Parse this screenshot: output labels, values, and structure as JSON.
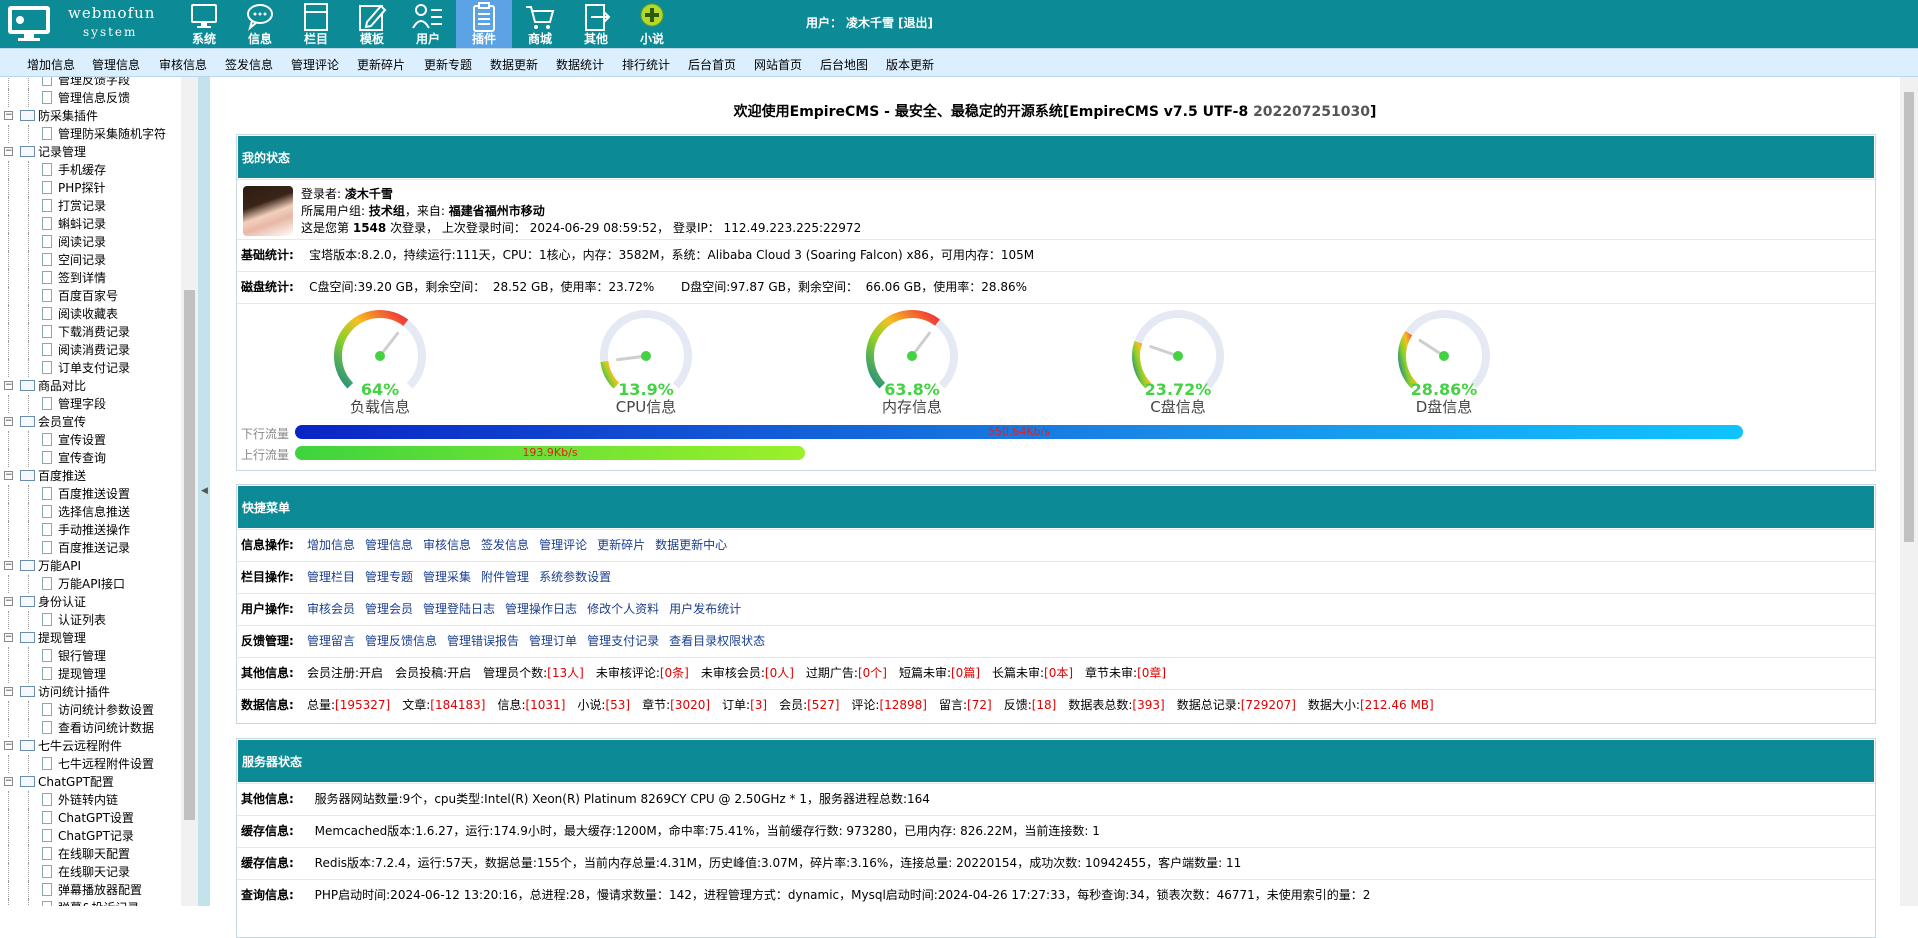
{
  "app": {
    "name_line1": "webmofun",
    "name_line2": "system"
  },
  "topnav": [
    {
      "label": "系统",
      "icon": "monitor-icon"
    },
    {
      "label": "信息",
      "icon": "chat-bubble-icon"
    },
    {
      "label": "栏目",
      "icon": "layout-icon"
    },
    {
      "label": "模板",
      "icon": "pencil-edit-icon"
    },
    {
      "label": "用户",
      "icon": "user-list-icon"
    },
    {
      "label": "插件",
      "icon": "clipboard-icon",
      "active": true
    },
    {
      "label": "商城",
      "icon": "cart-icon"
    },
    {
      "label": "其他",
      "icon": "logout-box-icon"
    },
    {
      "label": "小说",
      "icon": "plus-circle-icon"
    }
  ],
  "user_bar": {
    "label": "用户：",
    "name": "凌木千雪",
    "logout": "[退出]"
  },
  "menubar": [
    "增加信息",
    "管理信息",
    "审核信息",
    "签发信息",
    "管理评论",
    "更新碎片",
    "更新专题",
    "数据更新",
    "数据统计",
    "排行统计",
    "后台首页",
    "网站首页",
    "后台地图",
    "版本更新"
  ],
  "tree": [
    {
      "t": "leaf",
      "label": "管理反馈字段"
    },
    {
      "t": "leaf",
      "label": "管理信息反馈"
    },
    {
      "t": "grp",
      "label": "防采集插件"
    },
    {
      "t": "leaf",
      "label": "管理防采集随机字符"
    },
    {
      "t": "grp",
      "label": "记录管理"
    },
    {
      "t": "leaf",
      "label": "手机缓存"
    },
    {
      "t": "leaf",
      "label": "PHP探针"
    },
    {
      "t": "leaf",
      "label": "打赏记录"
    },
    {
      "t": "leaf",
      "label": "蝌蚪记录"
    },
    {
      "t": "leaf",
      "label": "阅读记录"
    },
    {
      "t": "leaf",
      "label": "空间记录"
    },
    {
      "t": "leaf",
      "label": "签到详情"
    },
    {
      "t": "leaf",
      "label": "百度百家号"
    },
    {
      "t": "leaf",
      "label": "阅读收藏表"
    },
    {
      "t": "leaf",
      "label": "下载消费记录"
    },
    {
      "t": "leaf",
      "label": "阅读消费记录"
    },
    {
      "t": "leaf",
      "label": "订单支付记录"
    },
    {
      "t": "grp",
      "label": "商品对比"
    },
    {
      "t": "leaf",
      "label": "管理字段"
    },
    {
      "t": "grp",
      "label": "会员宣传"
    },
    {
      "t": "leaf",
      "label": "宣传设置"
    },
    {
      "t": "leaf",
      "label": "宣传查询"
    },
    {
      "t": "grp",
      "label": "百度推送"
    },
    {
      "t": "leaf",
      "label": "百度推送设置"
    },
    {
      "t": "leaf",
      "label": "选择信息推送"
    },
    {
      "t": "leaf",
      "label": "手动推送操作"
    },
    {
      "t": "leaf",
      "label": "百度推送记录"
    },
    {
      "t": "grp",
      "label": "万能API"
    },
    {
      "t": "leaf",
      "label": "万能API接口"
    },
    {
      "t": "grp",
      "label": "身份认证"
    },
    {
      "t": "leaf",
      "label": "认证列表"
    },
    {
      "t": "grp",
      "label": "提现管理"
    },
    {
      "t": "leaf",
      "label": "银行管理"
    },
    {
      "t": "leaf",
      "label": "提现管理"
    },
    {
      "t": "grp",
      "label": "访问统计插件"
    },
    {
      "t": "leaf",
      "label": "访问统计参数设置"
    },
    {
      "t": "leaf",
      "label": "查看访问统计数据"
    },
    {
      "t": "grp",
      "label": "七牛云远程附件"
    },
    {
      "t": "leaf",
      "label": "七牛远程附件设置"
    },
    {
      "t": "grp",
      "label": "ChatGPT配置"
    },
    {
      "t": "leaf",
      "label": "外链转内链"
    },
    {
      "t": "leaf",
      "label": "ChatGPT设置"
    },
    {
      "t": "leaf",
      "label": "ChatGPT记录"
    },
    {
      "t": "leaf",
      "label": "在线聊天配置"
    },
    {
      "t": "leaf",
      "label": "在线聊天记录"
    },
    {
      "t": "leaf",
      "label": "弹幕播放器配置"
    },
    {
      "t": "leaf",
      "label": "弹幕&投诉记录"
    }
  ],
  "welcome": {
    "text": "欢迎使用EmpireCMS - 最安全、最稳定的开源系统[EmpireCMS v7.5 UTF-8 ",
    "version": "202207251030",
    "tail": "]"
  },
  "status": {
    "title": "我的状态",
    "login_line1_label": "登录者:",
    "login_user": "凌木千雪",
    "group_label": "所属用户组:",
    "group": "技术组",
    "from_label": "，来自:",
    "from": "福建省福州市移动",
    "count_pre": "这是您第",
    "count": "1548",
    "count_post": "次登录，  上次登录时间：  2024-06-29 08:59:52，  登录IP：  112.49.223.225:22972",
    "basic_label": "基础统计:",
    "basic_text": "宝塔版本:8.2.0，持续运行:111天，CPU：1核心，内存：3582M，系统：Alibaba Cloud 3 (Soaring Falcon) x86，可用内存：105M",
    "disk_label": "磁盘统计:",
    "disk_text": "C盘空间:39.20 GB，剩余空间：  28.52 GB，使用率：23.72%       D盘空间:97.87 GB，剩余空间：  66.06 GB，使用率：28.86%"
  },
  "gauges": [
    {
      "label": "负载信息",
      "value_text": "64%",
      "value": 0.64
    },
    {
      "label": "CPU信息",
      "value_text": "13.9%",
      "value": 0.139
    },
    {
      "label": "内存信息",
      "value_text": "63.8%",
      "value": 0.638
    },
    {
      "label": "C盘信息",
      "value_text": "23.72%",
      "value": 0.2372
    },
    {
      "label": "D盘信息",
      "value_text": "28.86%",
      "value": 0.2886
    }
  ],
  "traffic": {
    "down_label": "下行流量",
    "down_value": "550.64Kb/s",
    "down_fraction": 1.0,
    "up_label": "上行流量",
    "up_value": "193.9Kb/s",
    "up_fraction": 0.352
  },
  "quick": {
    "title": "快捷菜单",
    "rows": [
      {
        "label": "信息操作:",
        "links": [
          "增加信息",
          "管理信息",
          "审核信息",
          "签发信息",
          "管理评论",
          "更新碎片",
          "数据更新中心"
        ]
      },
      {
        "label": "栏目操作:",
        "links": [
          "管理栏目",
          "管理专题",
          "管理采集",
          "附件管理",
          "系统参数设置"
        ]
      },
      {
        "label": "用户操作:",
        "links": [
          "审核会员",
          "管理会员",
          "管理登陆日志",
          "管理操作日志",
          "修改个人资料",
          "用户发布统计"
        ]
      },
      {
        "label": "反馈管理:",
        "links": [
          "管理留言",
          "管理反馈信息",
          "管理错误报告",
          "管理订单",
          "管理支付记录",
          "查看目录权限状态"
        ]
      }
    ],
    "other_label": "其他信息:",
    "other": [
      {
        "k": "会员注册:",
        "v": "开启"
      },
      {
        "k": "会员投稿:",
        "v": "开启"
      },
      {
        "k": "管理员个数:",
        "v": "[13人]",
        "red": true
      },
      {
        "k": "未审核评论:",
        "v": "[0条]",
        "red": true
      },
      {
        "k": "未审核会员:",
        "v": "[0人]",
        "red": true
      },
      {
        "k": "过期广告:",
        "v": "[0个]",
        "red": true
      },
      {
        "k": "短篇未审:",
        "v": "[0篇]",
        "red": true
      },
      {
        "k": "长篇未审:",
        "v": "[0本]",
        "red": true
      },
      {
        "k": "章节未审:",
        "v": "[0章]",
        "red": true
      }
    ],
    "data_label": "数据信息:",
    "data": [
      {
        "k": "总量:",
        "v": "[195327]"
      },
      {
        "k": "文章:",
        "v": "[184183]"
      },
      {
        "k": "信息:",
        "v": "[1031]"
      },
      {
        "k": "小说:",
        "v": "[53]"
      },
      {
        "k": "章节:",
        "v": "[3020]"
      },
      {
        "k": "订单:",
        "v": "[3]"
      },
      {
        "k": "会员:",
        "v": "[527]"
      },
      {
        "k": "评论:",
        "v": "[12898]"
      },
      {
        "k": "留言:",
        "v": "[72]"
      },
      {
        "k": "反馈:",
        "v": "[18]"
      },
      {
        "k": "数据表总数:",
        "v": "[393]"
      },
      {
        "k": "数据总记录:",
        "v": "[729207]"
      },
      {
        "k": "数据大小:",
        "v": "[212.46 MB]"
      }
    ]
  },
  "server": {
    "title": "服务器状态",
    "rows": [
      {
        "label": "其他信息:",
        "text": "服务器网站数量:9个，cpu类型:Intel(R) Xeon(R) Platinum 8269CY CPU @ 2.50GHz * 1，服务器进程总数:164"
      },
      {
        "label": "缓存信息:",
        "text": "Memcached版本:1.6.27，运行:174.9小时，最大缓存:1200M，命中率:75.41%，当前缓存行数:  973280，已用内存:  826.22M，当前连接数:  1"
      },
      {
        "label": "缓存信息:",
        "text": "Redis版本:7.2.4，运行:57天，数据总量:155个，当前内存总量:4.31M，历史峰值:3.07M，碎片率:3.16%，连接总量:  20220154，成功次数:  10942455，客户端数量:  11"
      },
      {
        "label": "查询信息:",
        "text": "PHP启动时间:2024-06-12 13:20:16，总进程:28，慢请求数量：142，进程管理方式：dynamic，Mysql启动时间:2024-04-26 17:27:33，每秒查询:34，锁表次数：46771，未使用索引的量：2"
      }
    ]
  },
  "colors": {
    "teal": "#0c8a96",
    "active_tab": "#5ba3e4",
    "menubar": "#dcefff",
    "gauge_green": "#44d244"
  }
}
